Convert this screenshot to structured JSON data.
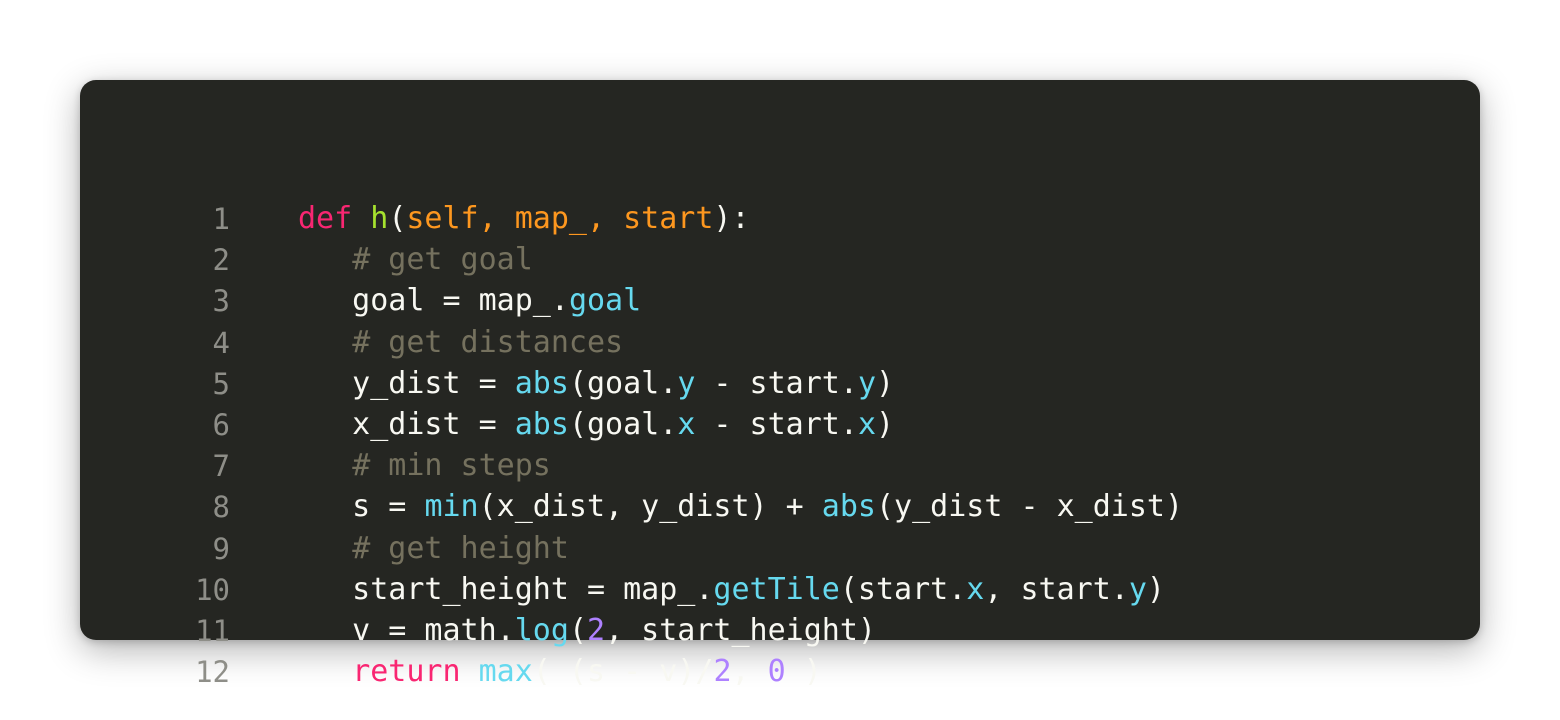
{
  "colors": {
    "background": "#252622",
    "plain": "#f8f8f2",
    "keyword": "#f92672",
    "function_name": "#a6e22e",
    "parameter": "#fd971f",
    "builtin": "#66d9ef",
    "number": "#ae81ff",
    "comment": "#75715e",
    "line_number": "#8e8e88"
  },
  "code": {
    "lines": [
      {
        "n": "1",
        "tokens": [
          [
            "kw",
            "def"
          ],
          [
            "pl",
            " "
          ],
          [
            "fn",
            "h"
          ],
          [
            "pl",
            "("
          ],
          [
            "prm",
            "self, map_, start"
          ],
          [
            "pl",
            "):"
          ]
        ]
      },
      {
        "n": "2",
        "tokens": [
          [
            "pl",
            "   "
          ],
          [
            "cm",
            "# get goal"
          ]
        ]
      },
      {
        "n": "3",
        "tokens": [
          [
            "pl",
            "   goal = map_."
          ],
          [
            "bi",
            "goal"
          ]
        ]
      },
      {
        "n": "4",
        "tokens": [
          [
            "pl",
            "   "
          ],
          [
            "cm",
            "# get distances"
          ]
        ]
      },
      {
        "n": "5",
        "tokens": [
          [
            "pl",
            "   y_dist = "
          ],
          [
            "bi",
            "abs"
          ],
          [
            "pl",
            "(goal."
          ],
          [
            "bi",
            "y"
          ],
          [
            "pl",
            " - start."
          ],
          [
            "bi",
            "y"
          ],
          [
            "pl",
            ")"
          ]
        ]
      },
      {
        "n": "6",
        "tokens": [
          [
            "pl",
            "   x_dist = "
          ],
          [
            "bi",
            "abs"
          ],
          [
            "pl",
            "(goal."
          ],
          [
            "bi",
            "x"
          ],
          [
            "pl",
            " - start."
          ],
          [
            "bi",
            "x"
          ],
          [
            "pl",
            ")"
          ]
        ]
      },
      {
        "n": "7",
        "tokens": [
          [
            "pl",
            "   "
          ],
          [
            "cm",
            "# min steps"
          ]
        ]
      },
      {
        "n": "8",
        "tokens": [
          [
            "pl",
            "   s = "
          ],
          [
            "bi",
            "min"
          ],
          [
            "pl",
            "(x_dist, y_dist) + "
          ],
          [
            "bi",
            "abs"
          ],
          [
            "pl",
            "(y_dist - x_dist)"
          ]
        ]
      },
      {
        "n": "9",
        "tokens": [
          [
            "pl",
            "   "
          ],
          [
            "cm",
            "# get height"
          ]
        ]
      },
      {
        "n": "10",
        "tokens": [
          [
            "pl",
            "   start_height = map_."
          ],
          [
            "bi",
            "getTile"
          ],
          [
            "pl",
            "(start."
          ],
          [
            "bi",
            "x"
          ],
          [
            "pl",
            ", start."
          ],
          [
            "bi",
            "y"
          ],
          [
            "pl",
            ")"
          ]
        ]
      },
      {
        "n": "11",
        "tokens": [
          [
            "pl",
            "   v = math."
          ],
          [
            "bi",
            "log"
          ],
          [
            "pl",
            "("
          ],
          [
            "num",
            "2"
          ],
          [
            "pl",
            ", start_height)"
          ]
        ]
      },
      {
        "n": "12",
        "tokens": [
          [
            "pl",
            "   "
          ],
          [
            "kw",
            "return"
          ],
          [
            "pl",
            " "
          ],
          [
            "bi",
            "max"
          ],
          [
            "pl",
            "( (s - v)/"
          ],
          [
            "num",
            "2"
          ],
          [
            "pl",
            ", "
          ],
          [
            "num",
            "0"
          ],
          [
            "pl",
            " )"
          ]
        ]
      }
    ]
  }
}
